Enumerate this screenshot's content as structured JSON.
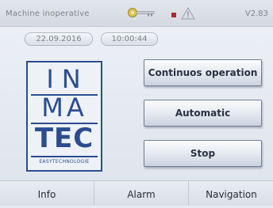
{
  "status_bar": {
    "status_text": "Machine inoperative",
    "version": "V2.83",
    "icons": [
      "key-icon",
      "stop-indicator-icon",
      "warning-icon"
    ]
  },
  "datetime": {
    "date": "22.09.2016",
    "time": "10:00:44"
  },
  "logo": {
    "line1": "IN",
    "line2": "MA",
    "line3": "TEC",
    "tagline": "EASYTECHNOLOGIE",
    "color": "#2b4d8f"
  },
  "actions": {
    "continuous": "Continuos operation",
    "automatic": "Automatic",
    "stop": "Stop"
  },
  "tabs": {
    "info": "Info",
    "alarm": "Alarm",
    "navigation": "Navigation"
  },
  "colors": {
    "status_red": "#b0272c",
    "key_yellow": "#e0c54a"
  }
}
